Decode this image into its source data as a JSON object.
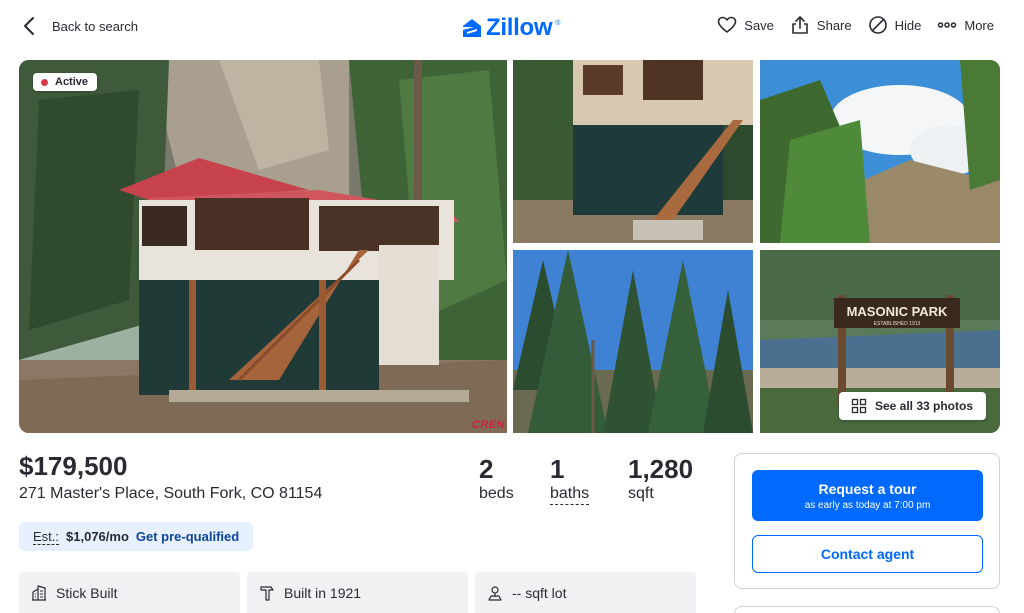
{
  "header": {
    "back_label": "Back to search",
    "logo_text": "Zillow",
    "logo_mark": "®",
    "actions": [
      {
        "label": "Save",
        "icon": "heart-icon"
      },
      {
        "label": "Share",
        "icon": "share-icon"
      },
      {
        "label": "Hide",
        "icon": "hide-icon"
      },
      {
        "label": "More",
        "icon": "more-icon"
      }
    ]
  },
  "gallery": {
    "status_badge": "Active",
    "see_all_label": "See all 33 photos",
    "watermark": "CREN",
    "sign_text": "MASONIC PARK",
    "sign_subtext": "ESTABLISHED 1913"
  },
  "listing": {
    "price": "$179,500",
    "address": "271 Master's Place, South Fork, CO 81154",
    "beds": {
      "value": "2",
      "label": "beds"
    },
    "baths": {
      "value": "1",
      "label": "baths"
    },
    "sqft": {
      "value": "1,280",
      "label": "sqft"
    },
    "estimate_label": "Est.:",
    "estimate_value": "$1,076/mo",
    "prequal_link": "Get pre-qualified"
  },
  "facts": [
    {
      "label": "Stick Built",
      "icon": "building-icon"
    },
    {
      "label": "Built in 1921",
      "icon": "hammer-icon"
    },
    {
      "label": "-- sqft lot",
      "icon": "lot-icon"
    }
  ],
  "sidebar": {
    "tour_button": "Request a tour",
    "tour_sub": "as early as today at 7:00 pm",
    "contact_button": "Contact agent"
  },
  "colors": {
    "brand": "#006aff",
    "active_dot": "#d63a4a",
    "estimate_bg": "#e6f0ff",
    "link": "#0d4599"
  }
}
